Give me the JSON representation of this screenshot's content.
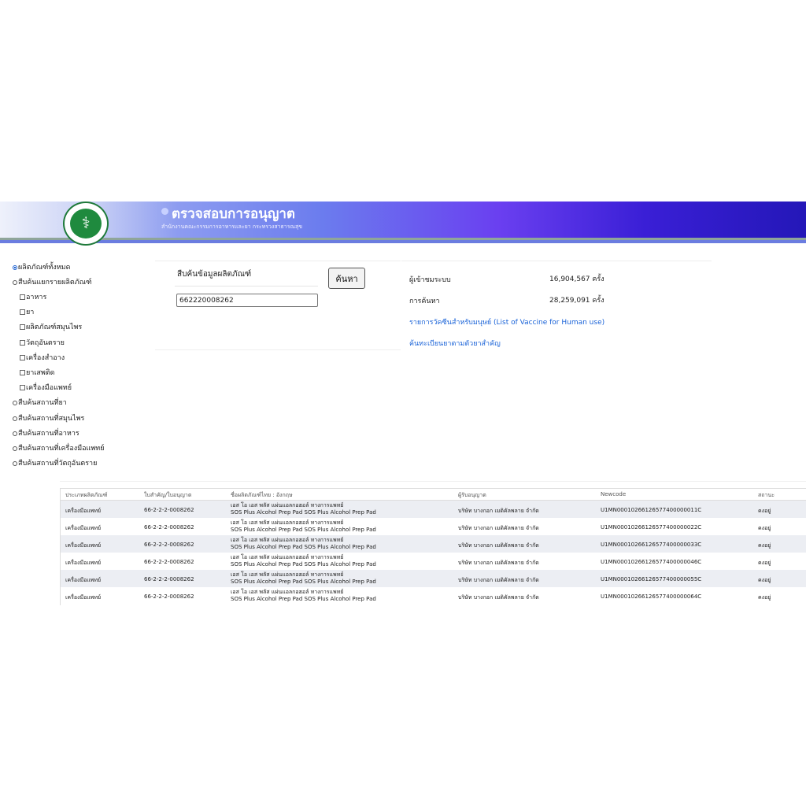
{
  "header": {
    "title": "ตรวจสอบการอนุญาต",
    "subtitle": "สำนักงานคณะกรรมการอาหารและยา กระทรวงสาธารณสุข",
    "logo_text": "MINISTRY OF PUBLIC HEALTH"
  },
  "sidebar": {
    "items": [
      {
        "label": "ผลิตภัณฑ์ทั้งหมด",
        "control": "radio",
        "checked": true
      },
      {
        "label": "สืบค้นแยกรายผลิตภัณฑ์",
        "control": "radio",
        "checked": false
      },
      {
        "label": "อาหาร",
        "control": "checkbox",
        "checked": false
      },
      {
        "label": "ยา",
        "control": "checkbox",
        "checked": false
      },
      {
        "label": "ผลิตภัณฑ์สมุนไพร",
        "control": "checkbox",
        "checked": false
      },
      {
        "label": "วัตถุอันตราย",
        "control": "checkbox",
        "checked": false
      },
      {
        "label": "เครื่องสำอาง",
        "control": "checkbox",
        "checked": false
      },
      {
        "label": "ยาเสพติด",
        "control": "checkbox",
        "checked": false
      },
      {
        "label": "เครื่องมือแพทย์",
        "control": "checkbox",
        "checked": false
      },
      {
        "label": "สืบค้นสถานที่ยา",
        "control": "radio",
        "checked": false
      },
      {
        "label": "สืบค้นสถานที่สมุนไพร",
        "control": "radio",
        "checked": false
      },
      {
        "label": "สืบค้นสถานที่อาหาร",
        "control": "radio",
        "checked": false
      },
      {
        "label": "สืบค้นสถานที่เครื่องมือแพทย์",
        "control": "radio",
        "checked": false
      },
      {
        "label": "สืบค้นสถานที่วัตถุอันตราย",
        "control": "radio",
        "checked": false
      }
    ]
  },
  "search": {
    "title": "สืบค้นข้อมูลผลิตภัณฑ์",
    "value": "662220008262",
    "button_label": "ค้นหา"
  },
  "stats": {
    "visitors_label": "ผู้เข้าชมระบบ",
    "visitors_value": "16,904,567 ครั้ง",
    "searches_label": "การค้นหา",
    "searches_value": "28,259,091 ครั้ง"
  },
  "links": {
    "vaccine": "รายการวัคซีนสำหรับมนุษย์ (List of Vaccine for Human use)",
    "drug_search": "ค้นทะเบียนยาตามตัวยาสำคัญ"
  },
  "table": {
    "headers": [
      "ประเภทผลิตภัณฑ์",
      "ใบสำคัญ/ใบอนุญาต",
      "ชื่อผลิตภัณฑ์ไทย : อังกฤษ",
      "ผู้รับอนุญาต",
      "Newcode",
      "สถานะ"
    ],
    "rows": [
      {
        "type": "เครื่องมือแพทย์",
        "license": "66-2-2-2-0008262",
        "name_th": "เอส โอ เอส พลัส แผ่นแอลกอฮอล์ ทางการแพทย์",
        "name_en": "SOS Plus Alcohol Prep Pad SOS Plus Alcohol Prep Pad",
        "holder": "บริษัท บางกอก เมดิคัลพลาย จำกัด",
        "newcode": "U1MN00010266126577400000011C",
        "status": "คงอยู่"
      },
      {
        "type": "เครื่องมือแพทย์",
        "license": "66-2-2-2-0008262",
        "name_th": "เอส โอ เอส พลัส แผ่นแอลกอฮอล์ ทางการแพทย์",
        "name_en": "SOS Plus Alcohol Prep Pad SOS Plus Alcohol Prep Pad",
        "holder": "บริษัท บางกอก เมดิคัลพลาย จำกัด",
        "newcode": "U1MN00010266126577400000022C",
        "status": "คงอยู่"
      },
      {
        "type": "เครื่องมือแพทย์",
        "license": "66-2-2-2-0008262",
        "name_th": "เอส โอ เอส พลัส แผ่นแอลกอฮอล์ ทางการแพทย์",
        "name_en": "SOS Plus Alcohol Prep Pad SOS Plus Alcohol Prep Pad",
        "holder": "บริษัท บางกอก เมดิคัลพลาย จำกัด",
        "newcode": "U1MN00010266126577400000033C",
        "status": "คงอยู่"
      },
      {
        "type": "เครื่องมือแพทย์",
        "license": "66-2-2-2-0008262",
        "name_th": "เอส โอ เอส พลัส แผ่นแอลกอฮอล์ ทางการแพทย์",
        "name_en": "SOS Plus Alcohol Prep Pad SOS Plus Alcohol Prep Pad",
        "holder": "บริษัท บางกอก เมดิคัลพลาย จำกัด",
        "newcode": "U1MN00010266126577400000046C",
        "status": "คงอยู่"
      },
      {
        "type": "เครื่องมือแพทย์",
        "license": "66-2-2-2-0008262",
        "name_th": "เอส โอ เอส พลัส แผ่นแอลกอฮอล์ ทางการแพทย์",
        "name_en": "SOS Plus Alcohol Prep Pad SOS Plus Alcohol Prep Pad",
        "holder": "บริษัท บางกอก เมดิคัลพลาย จำกัด",
        "newcode": "U1MN00010266126577400000055C",
        "status": "คงอยู่"
      },
      {
        "type": "เครื่องมือแพทย์",
        "license": "66-2-2-2-0008262",
        "name_th": "เอส โอ เอส พลัส แผ่นแอลกอฮอล์ ทางการแพทย์",
        "name_en": "SOS Plus Alcohol Prep Pad SOS Plus Alcohol Prep Pad",
        "holder": "บริษัท บางกอก เมดิคัลพลาย จำกัด",
        "newcode": "U1MN00010266126577400000064C",
        "status": "คงอยู่"
      }
    ]
  }
}
